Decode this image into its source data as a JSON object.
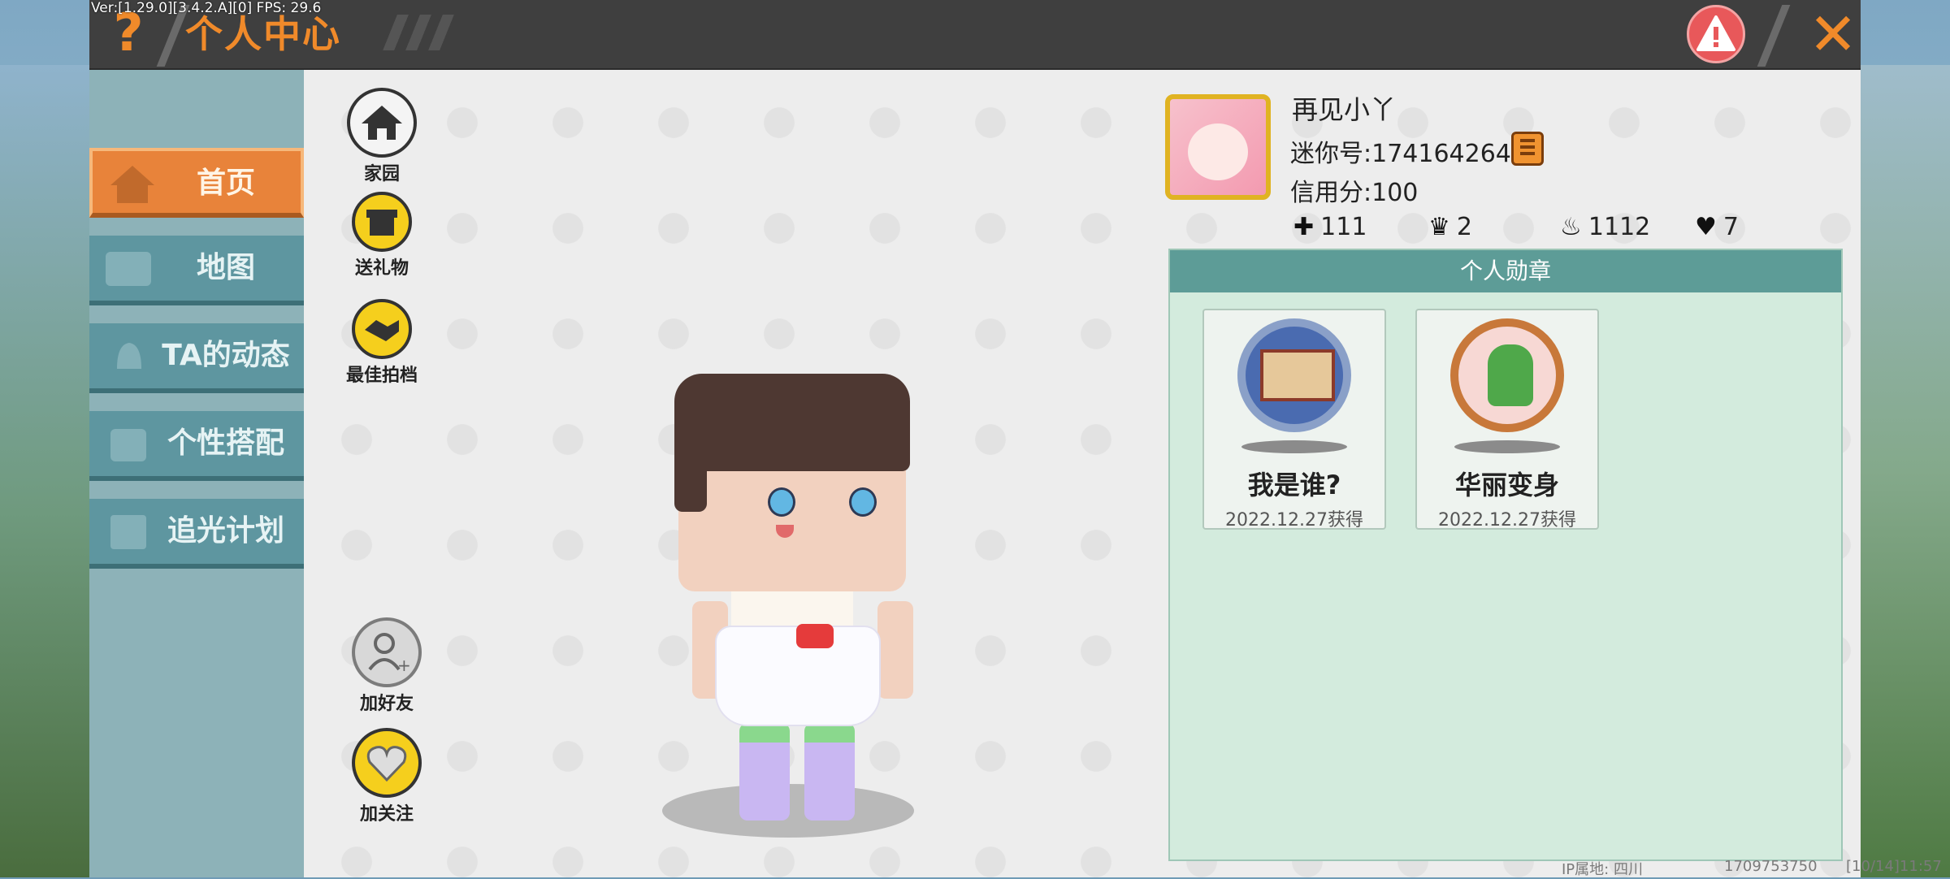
{
  "version": "Ver:[1.29.0][3.4.2.A][0] FPS: 29.6",
  "topbar": {
    "title": "个人中心"
  },
  "nav": {
    "items": [
      {
        "label": "首页",
        "icon": "home-tab-icon"
      },
      {
        "label": "地图",
        "icon": "map-icon"
      },
      {
        "label": "TA的动态",
        "icon": "bell-icon"
      },
      {
        "label": "个性搭配",
        "icon": "outfit-icon"
      },
      {
        "label": "追光计划",
        "icon": "plan-icon"
      }
    ]
  },
  "actions": {
    "home": "家园",
    "gift": "送礼物",
    "best": "最佳拍档",
    "add_friend": "加好友",
    "follow": "加关注"
  },
  "profile": {
    "name": "再见小丫",
    "mini_id": "迷你号:1741642641",
    "credit": "信用分:100",
    "stats": [
      {
        "icon": "plus-icon",
        "value": "111"
      },
      {
        "icon": "trophy-icon",
        "value": "2"
      },
      {
        "icon": "fire-icon",
        "value": "1112"
      },
      {
        "icon": "heart-icon",
        "value": "7"
      }
    ]
  },
  "medals": {
    "header": "个人勋章",
    "items": [
      {
        "name": "我是谁?",
        "date": "2022.12.27获得"
      },
      {
        "name": "华丽变身",
        "date": "2022.12.27获得"
      }
    ]
  },
  "footer": {
    "ip": "IP属地: 四川",
    "uid": "1709753750",
    "time": "[10/14]11:57"
  },
  "colors": {
    "accent": "#f08a2a",
    "nav": "#5e96a0",
    "medal_header": "#5d9c97"
  }
}
